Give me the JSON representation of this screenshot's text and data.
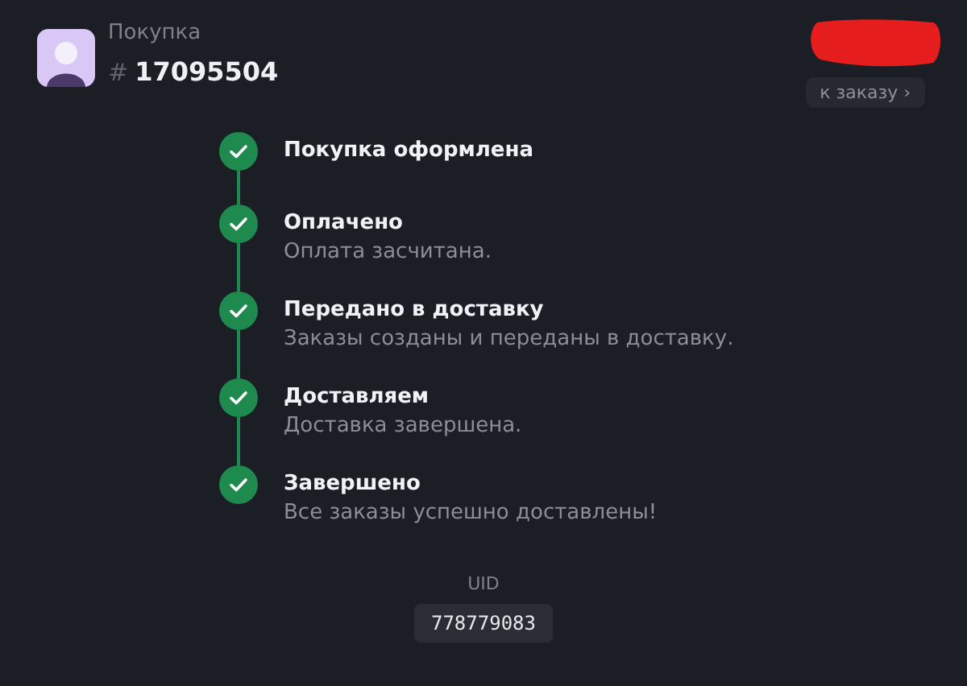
{
  "order": {
    "label": "Покупка",
    "hash": "#",
    "number": "17095504"
  },
  "order_link": {
    "label": "к заказу",
    "chevron": "›"
  },
  "steps": [
    {
      "title": "Покупка оформлена",
      "done": true
    },
    {
      "title": "Оплачено",
      "description": "Оплата засчитана.",
      "done": true
    },
    {
      "title": "Передано в доставку",
      "description": "Заказы созданы и переданы в доставку.",
      "done": true
    },
    {
      "title": "Доставляем",
      "description": "Доставка завершена.",
      "done": true
    },
    {
      "title": "Завершено",
      "description": "Все заказы успешно доставлены!",
      "done": true
    }
  ],
  "uid": {
    "label": "UID",
    "value": "778779083"
  }
}
